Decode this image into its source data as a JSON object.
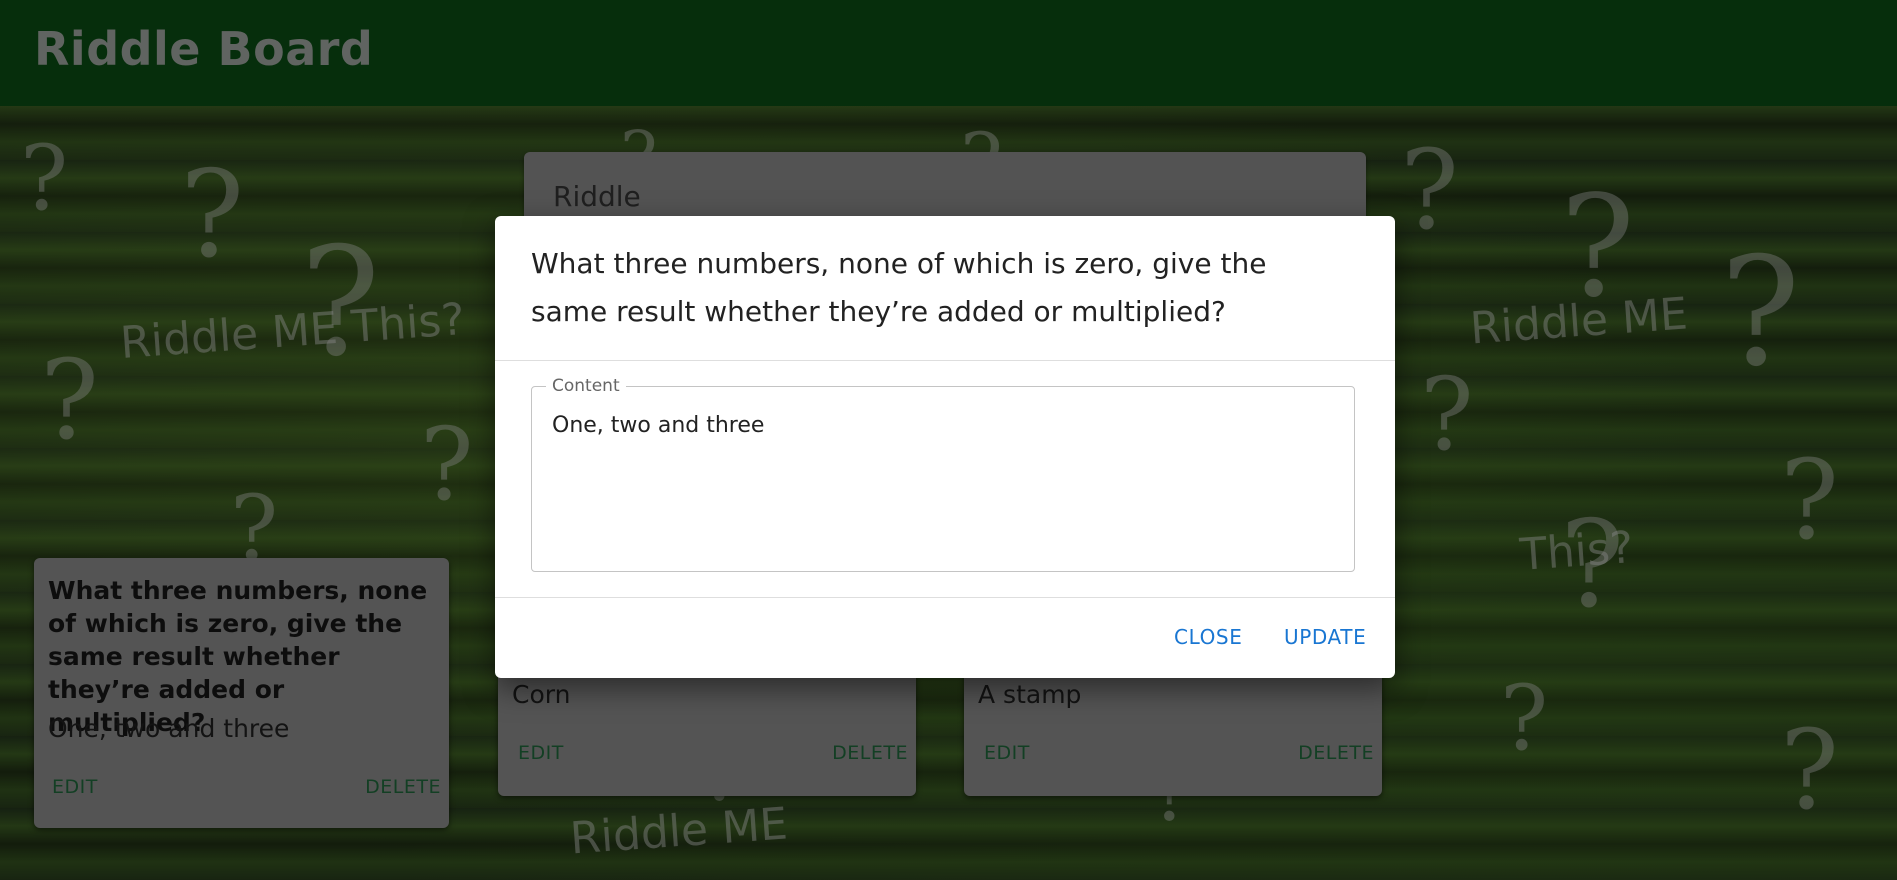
{
  "app": {
    "title": "Riddle Board"
  },
  "background": {
    "text_1": "Riddle ME This?",
    "text_2": "Riddle ME",
    "text_3": "This?",
    "text_4": "Riddle ME"
  },
  "form": {
    "riddle_label": "Riddle"
  },
  "cards": [
    {
      "question": "What three numbers, none of which is zero, give the same result whether they’re added or multiplied?",
      "answer": "One, two and three",
      "edit_label": "EDIT",
      "delete_label": "DELETE"
    },
    {
      "question": "",
      "answer": "Corn",
      "edit_label": "EDIT",
      "delete_label": "DELETE"
    },
    {
      "question": "",
      "answer": "A stamp",
      "edit_label": "EDIT",
      "delete_label": "DELETE"
    }
  ],
  "dialog": {
    "title": "What three numbers, none of which is zero, give the same result whether they’re added or multiplied?",
    "content_label": "Content",
    "content_value": "One, two and three",
    "close_label": "CLOSE",
    "update_label": "UPDATE"
  },
  "colors": {
    "header": "#0a4512",
    "card": "#7d7d7d",
    "card_button": "#1d5e35",
    "dialog_button": "#1976d2"
  }
}
